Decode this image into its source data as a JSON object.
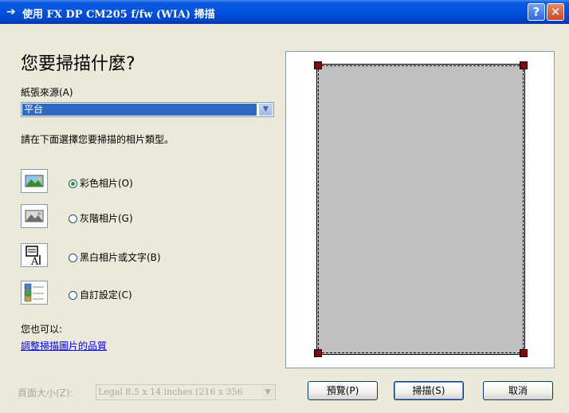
{
  "titlebar": {
    "title": "使用 FX DP CM205 f/fw (WIA) 掃描",
    "help_label": "?",
    "close_label": "✕"
  },
  "main": {
    "heading": "您要掃描什麼?",
    "paper_source_label": "紙張來源(A)",
    "paper_source_value": "平台",
    "select_prompt": "請在下面選擇您要掃描的相片類型。",
    "picture_types": [
      {
        "label": "彩色相片(O)",
        "icon": "color-picture-icon",
        "selected": true
      },
      {
        "label": "灰階相片(G)",
        "icon": "grayscale-picture-icon",
        "selected": false
      },
      {
        "label": "黑白相片或文字(B)",
        "icon": "black-white-text-icon",
        "selected": false
      },
      {
        "label": "自訂設定(C)",
        "icon": "custom-settings-icon",
        "selected": false
      }
    ],
    "also_label": "您也可以:",
    "adjust_link": "調整掃描圖片的品質",
    "page_size_label": "頁面大小(Z):",
    "page_size_value": "Legal 8.5 x 14 inches (216 x 356"
  },
  "buttons": {
    "preview": "預覽(P)",
    "scan": "掃描(S)",
    "cancel": "取消"
  },
  "colors": {
    "titlebar": "#0054E3",
    "selection": "#316AC5",
    "link": "#0000FF",
    "crop_handle": "#8B0000",
    "preview_page": "#C0C0C0"
  }
}
